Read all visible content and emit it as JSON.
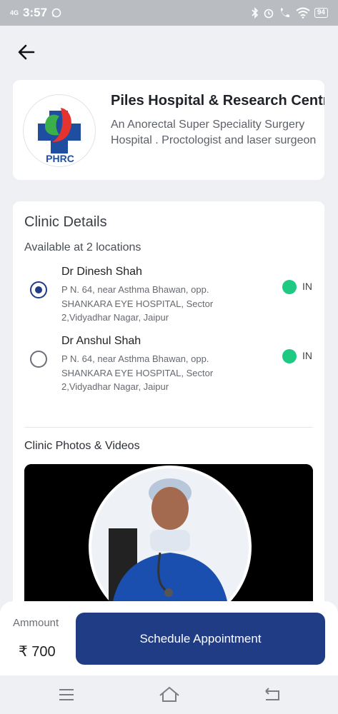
{
  "status_bar": {
    "network": "4G",
    "time": "3:57",
    "battery": "94"
  },
  "hospital": {
    "name": "Piles Hospital & Research Centre",
    "description": "An Anorectal Super Speciality Surgery Hospital . Proctologist and laser surgeon",
    "logo_text": "PHRC"
  },
  "clinic": {
    "title": "Clinic Details",
    "availability": "Available at 2 locations",
    "locations": [
      {
        "doctor": "Dr Dinesh Shah",
        "address": "P N. 64, near Asthma Bhawan, opp. SHANKARA EYE HOSPITAL, Sector 2,Vidyadhar Nagar, Jaipur",
        "status": "IN",
        "selected": true
      },
      {
        "doctor": "Dr Anshul Shah",
        "address": "P N. 64, near Asthma Bhawan, opp. SHANKARA EYE HOSPITAL, Sector 2,Vidyadhar Nagar, Jaipur",
        "status": "IN",
        "selected": false
      }
    ],
    "photos_title": "Clinic Photos & Videos"
  },
  "booking": {
    "amount_label": "Ammount",
    "amount": "₹ 700",
    "schedule_label": "Schedule Appointment"
  },
  "colors": {
    "primary": "#1f3c84",
    "status_in": "#1ec982",
    "logo_red": "#e5342f",
    "logo_green": "#3bb04a",
    "logo_blue": "#1f4ea0"
  }
}
